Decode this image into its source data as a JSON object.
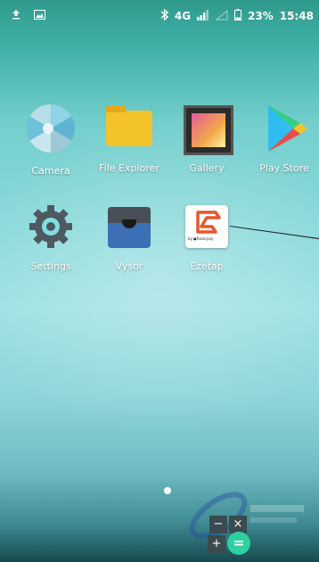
{
  "status_bar": {
    "network": "4G",
    "battery": "23%",
    "time": "15:48"
  },
  "apps": [
    {
      "label": "Camera",
      "icon": "camera-icon"
    },
    {
      "label": "File Explorer",
      "icon": "folder-icon"
    },
    {
      "label": "Gallery",
      "icon": "gallery-icon"
    },
    {
      "label": "Play Store",
      "icon": "play-store-icon"
    },
    {
      "label": "Settings",
      "icon": "settings-gear-icon"
    },
    {
      "label": "Vysor",
      "icon": "vysor-icon"
    },
    {
      "label": "Ezetap",
      "icon": "ezetap-icon"
    }
  ],
  "ezetap_badge": "by ●Razorpay",
  "floating_widget": {
    "minus": "−",
    "close": "×",
    "plus": "+",
    "equals": "="
  },
  "colors": {
    "accent_green": "#2ed0a0"
  }
}
